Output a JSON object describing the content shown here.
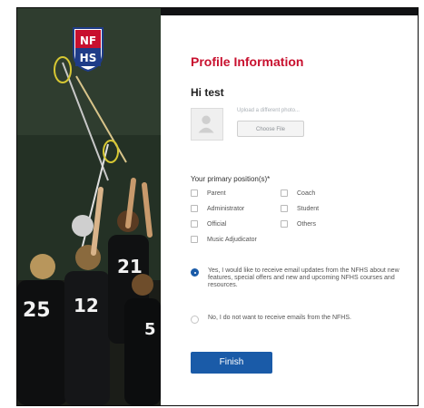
{
  "brand": {
    "logo_text": "NFHS",
    "accent_color": "#c8102e",
    "primary_color": "#1a5ba8"
  },
  "profile": {
    "title": "Profile Information",
    "greeting": "Hi test",
    "upload_label": "Upload a different photo...",
    "choose_file_label": "Choose File"
  },
  "positions": {
    "question": "Your primary position(s)*",
    "options": [
      "Parent",
      "Coach",
      "Administrator",
      "Student",
      "Official",
      "Others",
      "Music Adjudicator"
    ]
  },
  "email_pref": {
    "selected": "yes",
    "yes_label": "Yes, I would like to receive email updates from the NFHS about new features, special offers and new and upcoming NFHS courses and resources.",
    "no_label": "No, I do not want to receive emails from the NFHS."
  },
  "finish_label": "Finish"
}
